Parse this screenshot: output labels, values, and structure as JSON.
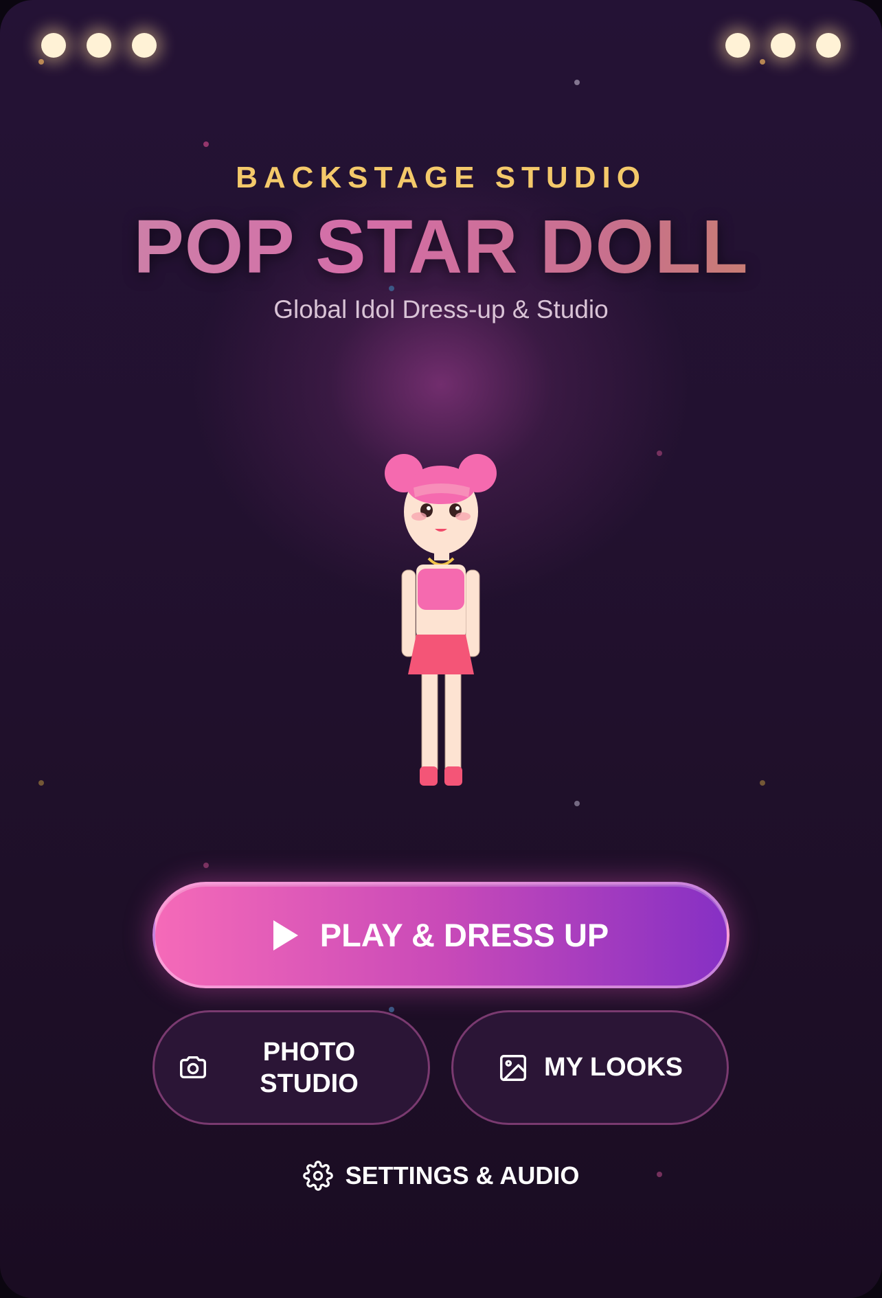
{
  "header": {
    "subtitle": "BACKSTAGE STUDIO",
    "title": "POP STAR DOLL",
    "tagline": "Global Idol Dress-up & Studio"
  },
  "menu": {
    "play_label": "PLAY & DRESS UP",
    "photo_label": "PHOTO STUDIO",
    "looks_label": "MY LOOKS",
    "settings_label": "SETTINGS & AUDIO"
  },
  "icons": {
    "play": "play-icon",
    "photo": "camera-icon",
    "looks": "image-icon",
    "settings": "gear-icon"
  },
  "colors": {
    "subtitle": "#f4c96a",
    "button_gradient_start": "#f56ab8",
    "button_gradient_end": "#8630c4",
    "doll_hair": "#f56aaf",
    "doll_skirt": "#f45577"
  }
}
